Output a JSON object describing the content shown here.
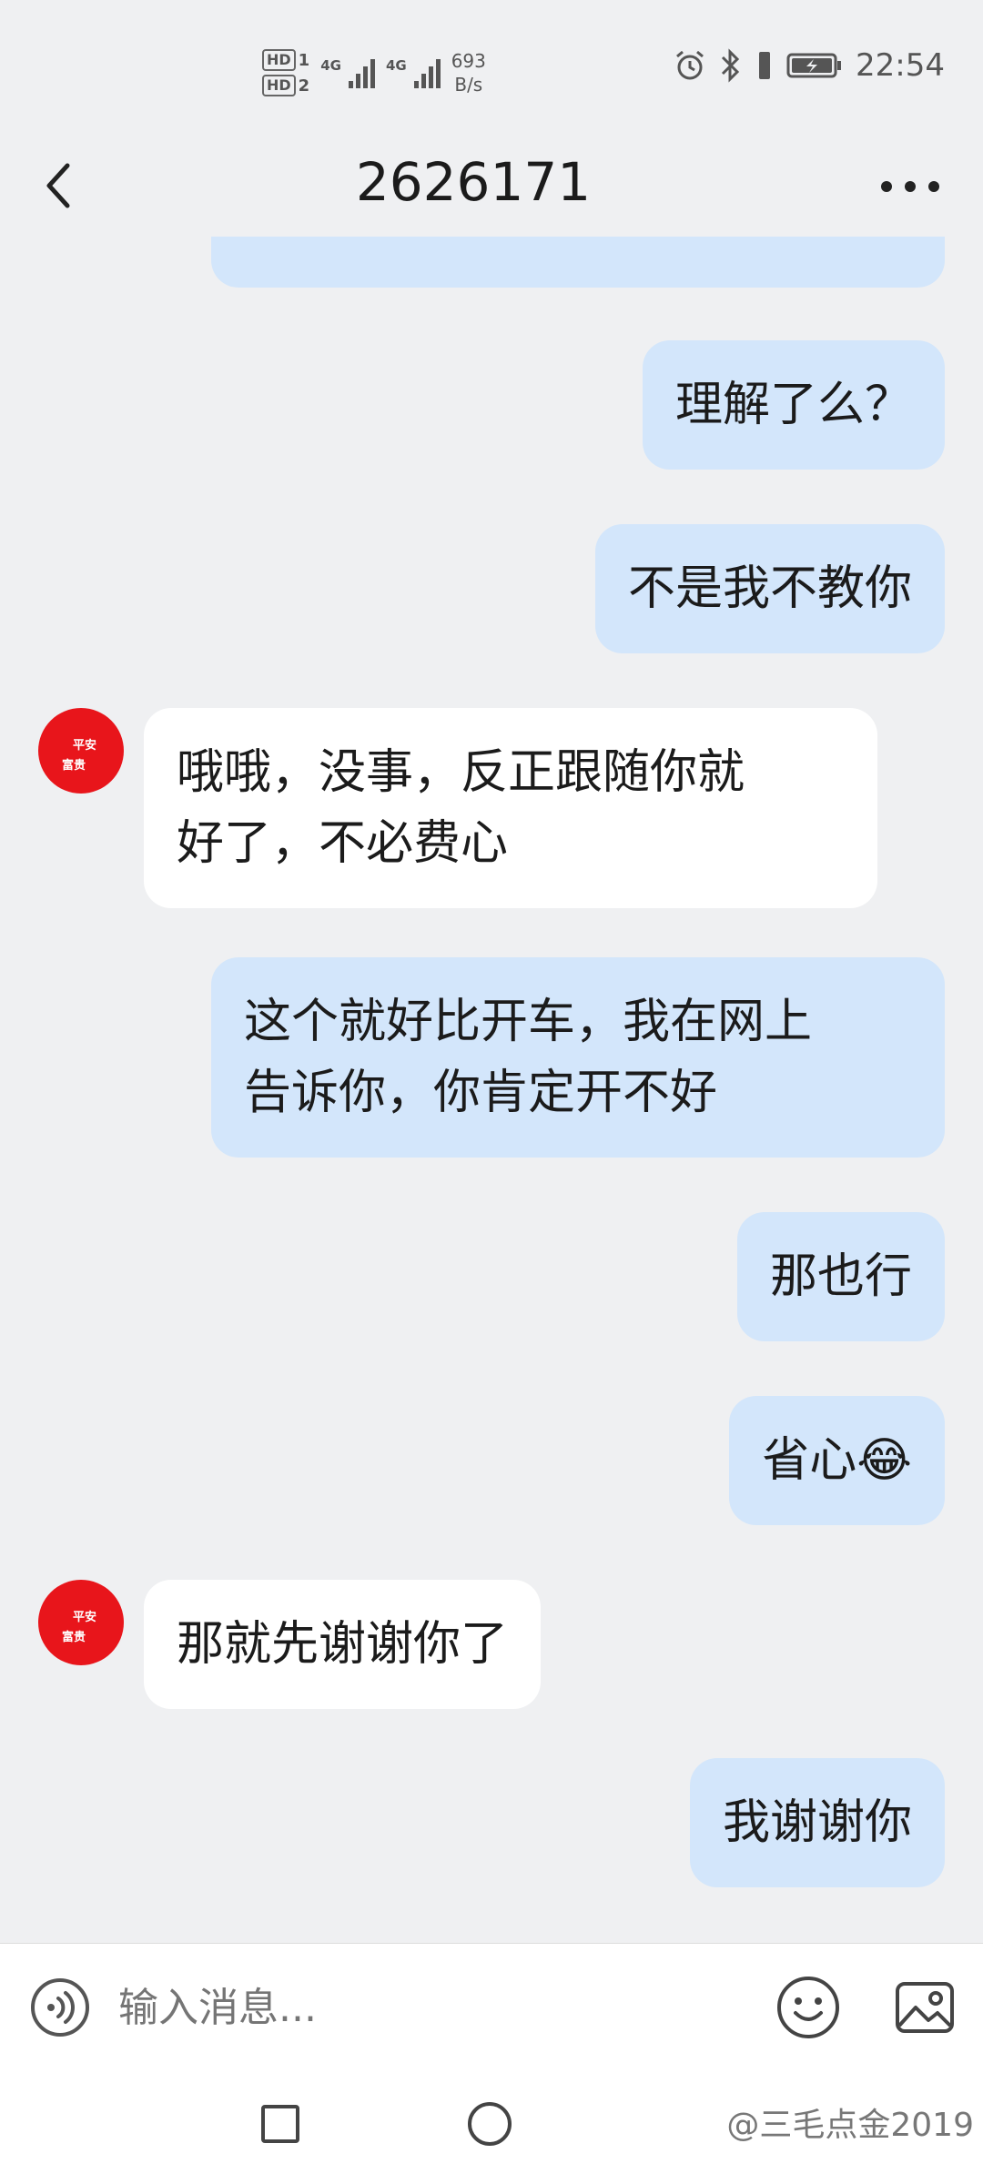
{
  "status_bar": {
    "sim1": "HD",
    "sim1_index": "1",
    "sim2": "HD",
    "sim2_index": "2",
    "network1": "4G",
    "network2": "4G",
    "speed_value": "693",
    "speed_unit": "B/s",
    "time": "22:54"
  },
  "header": {
    "title": "2626171"
  },
  "messages": [
    {
      "side": "out",
      "text": "理解了么？"
    },
    {
      "side": "out",
      "text": "不是我不教你"
    },
    {
      "side": "in",
      "lines": [
        "哦哦，没事，反正跟随你就",
        "好了，不必费心"
      ]
    },
    {
      "side": "out",
      "lines": [
        "这个就好比开车，我在网上",
        "告诉你，你肯定开不好"
      ]
    },
    {
      "side": "out",
      "text": "那也行"
    },
    {
      "side": "out",
      "text": "省心",
      "emoji": "😂"
    },
    {
      "side": "in",
      "text": "那就先谢谢你了"
    },
    {
      "side": "out",
      "text": "我谢谢你"
    }
  ],
  "avatar": {
    "label_main": "平安",
    "label_sub": "富贵"
  },
  "input_bar": {
    "placeholder": "输入消息..."
  },
  "watermark": "@三毛点金2019",
  "colors": {
    "background": "#eff0f2",
    "outgoing_bubble": "#d3e6fb",
    "incoming_bubble": "#ffffff",
    "avatar_red": "#e8151b"
  }
}
